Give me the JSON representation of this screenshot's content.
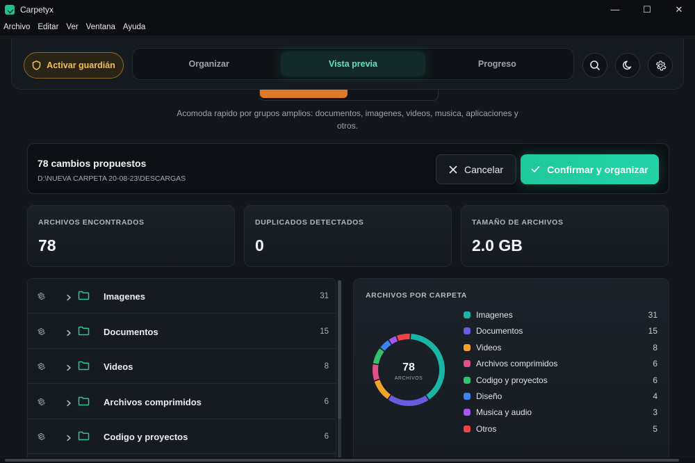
{
  "window": {
    "title": "Carpetyx",
    "minimize": "—",
    "maximize": "☐",
    "close": "✕"
  },
  "menu": [
    "Archivo",
    "Editar",
    "Ver",
    "Ventana",
    "Ayuda"
  ],
  "header": {
    "guard_label": "Activar guardián",
    "tabs": [
      {
        "label": "Organizar",
        "active": false
      },
      {
        "label": "Vista previa",
        "active": true
      },
      {
        "label": "Progreso",
        "active": false
      }
    ]
  },
  "mode_description": "Acomoda rapido por grupos amplios: documentos, imagenes, videos, musica, aplicaciones y otros.",
  "proposal": {
    "title": "78 cambios propuestos",
    "path": "D:\\NUEVA CARPETA 20-08-23\\DESCARGAS",
    "cancel_label": "Cancelar",
    "confirm_label": "Confirmar y organizar"
  },
  "stats": [
    {
      "label": "ARCHIVOS ENCONTRADOS",
      "value": "78"
    },
    {
      "label": "DUPLICADOS DETECTADOS",
      "value": "0"
    },
    {
      "label": "TAMAÑO DE ARCHIVOS",
      "value": "2.0 GB"
    }
  ],
  "folders": [
    {
      "name": "Imagenes",
      "count": "31"
    },
    {
      "name": "Documentos",
      "count": "15"
    },
    {
      "name": "Videos",
      "count": "8"
    },
    {
      "name": "Archivos comprimidos",
      "count": "6"
    },
    {
      "name": "Codigo y proyectos",
      "count": "6"
    }
  ],
  "chart_panel": {
    "title": "ARCHIVOS POR CARPETA",
    "center_value": "78",
    "center_label": "ARCHIVOS"
  },
  "chart_data": {
    "type": "pie",
    "categories": [
      "Imagenes",
      "Documentos",
      "Videos",
      "Archivos comprimidos",
      "Codigo y proyectos",
      "Diseño",
      "Musica y audio",
      "Otros"
    ],
    "values": [
      31,
      15,
      8,
      6,
      6,
      4,
      3,
      5
    ],
    "colors": [
      "#1bb5a6",
      "#6a5ae0",
      "#f2a32a",
      "#e0508a",
      "#34c26a",
      "#3c82f0",
      "#a855f7",
      "#ef4444"
    ]
  },
  "icons": {
    "guard": "shield-icon",
    "search": "search-icon",
    "theme": "moon-icon",
    "settings": "gear-icon"
  }
}
